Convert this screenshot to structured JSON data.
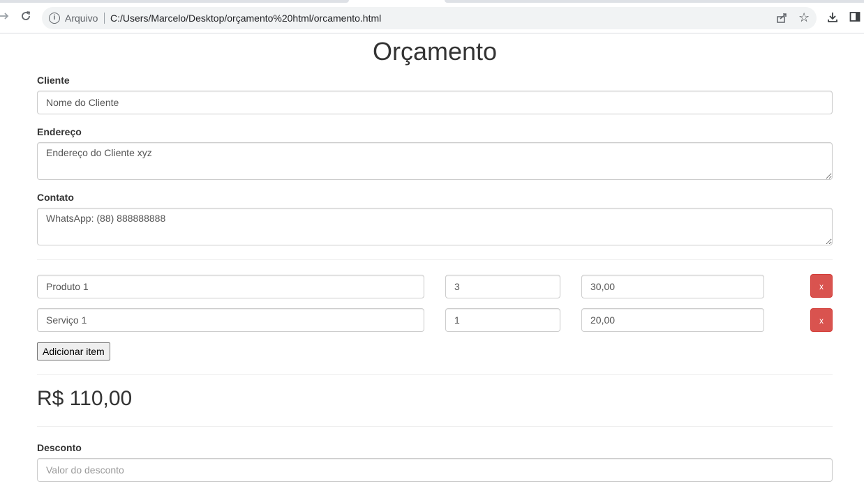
{
  "browser": {
    "protocol_label": "Arquivo",
    "url": "C:/Users/Marcelo/Desktop/orçamento%20html/orcamento.html"
  },
  "page": {
    "title": "Orçamento",
    "cliente": {
      "label": "Cliente",
      "value": "Nome do Cliente"
    },
    "endereco": {
      "label": "Endereço",
      "value": "Endereço do Cliente xyz"
    },
    "contato": {
      "label": "Contato",
      "value": "WhatsApp: (88) 888888888"
    },
    "items": [
      {
        "name": "Produto 1",
        "qty": "3",
        "price": "30,00",
        "remove_label": "x"
      },
      {
        "name": "Serviço 1",
        "qty": "1",
        "price": "20,00",
        "remove_label": "x"
      }
    ],
    "add_item_label": "Adicionar item",
    "total": "R$ 110,00",
    "desconto": {
      "label": "Desconto",
      "placeholder": "Valor do desconto"
    }
  },
  "colors": {
    "danger": "#d9534f",
    "text": "#333333"
  }
}
